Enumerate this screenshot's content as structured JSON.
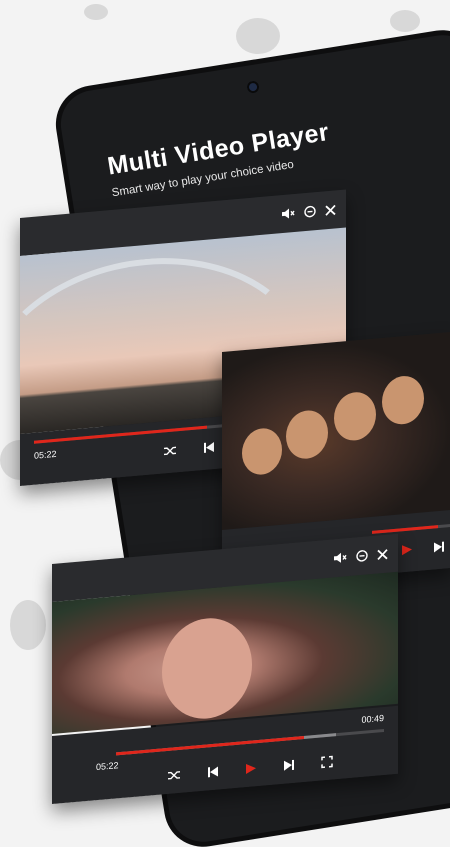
{
  "header": {
    "title": "Multi Video Player",
    "subtitle": "Smart way to play your choice video"
  },
  "players": [
    {
      "name": "bridge-video",
      "current_time": "05:22",
      "duration": "",
      "progress": 0.58
    },
    {
      "name": "friends-video",
      "current_time": "",
      "duration": "",
      "progress": 0.82
    },
    {
      "name": "girl-video",
      "current_time": "05:22",
      "duration": "00:49",
      "progress": 0.7,
      "buffer": 0.82
    }
  ],
  "icons": [
    "mute-icon",
    "minimize-icon",
    "close-icon",
    "shuffle-icon",
    "previous-icon",
    "play-icon",
    "next-icon",
    "fullscreen-icon"
  ],
  "colors": {
    "accent": "#e0261b",
    "phone": "#1b1c1e",
    "bar": "#2a2b2e",
    "background": "#f3f3f3"
  }
}
